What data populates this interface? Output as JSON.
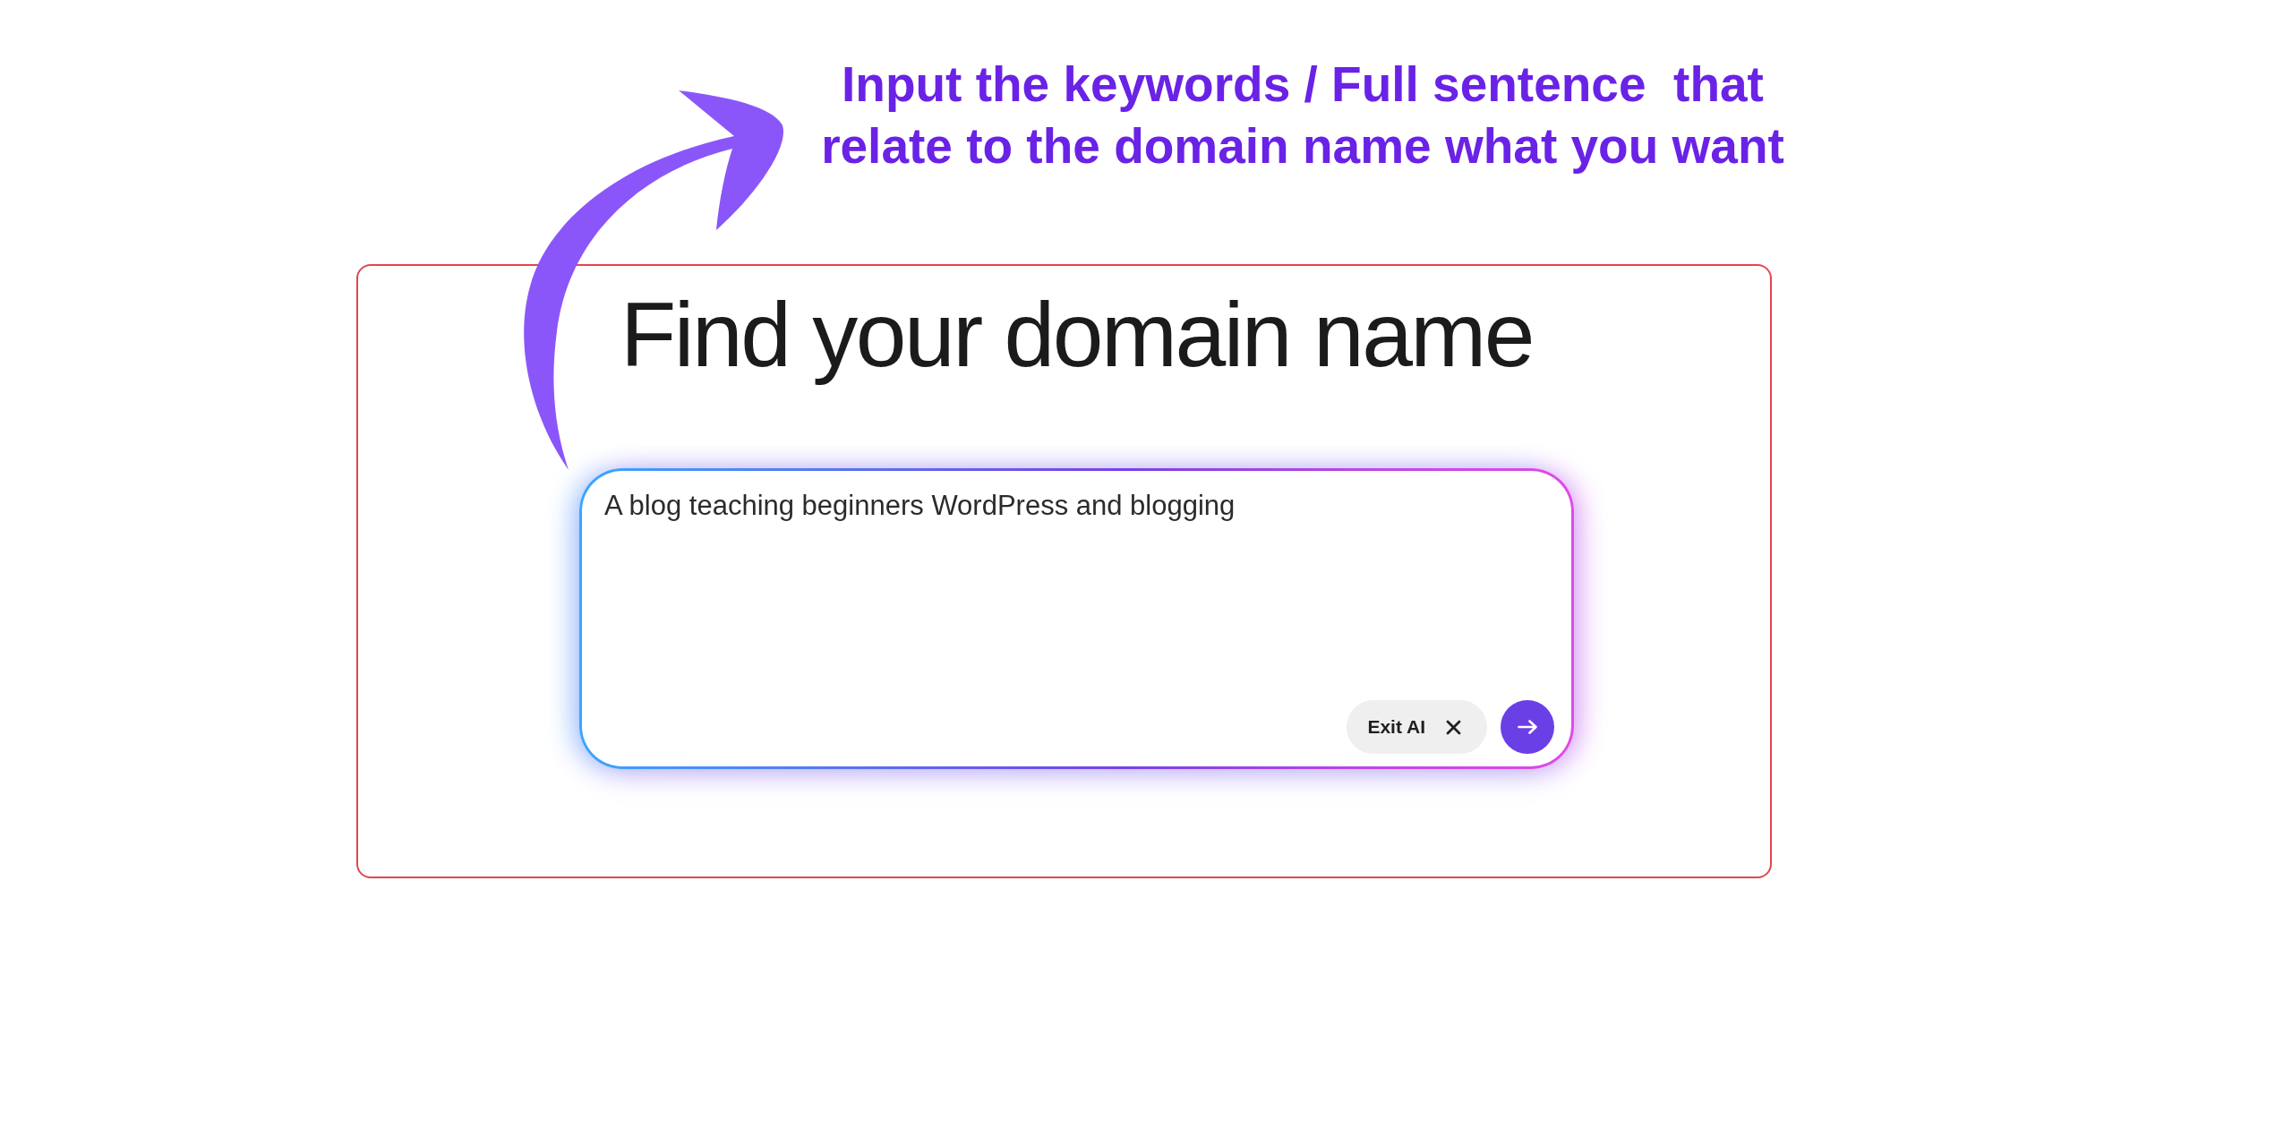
{
  "annotation": {
    "text": "Input the keywords / Full sentence  that relate to the domain name what you want"
  },
  "panel": {
    "heading": "Find your domain name",
    "prompt": {
      "value": "A blog teaching beginners WordPress and blogging",
      "buttons": [
        {
          "kind": "exit",
          "label": "Exit AI"
        },
        {
          "kind": "submit"
        }
      ]
    }
  }
}
